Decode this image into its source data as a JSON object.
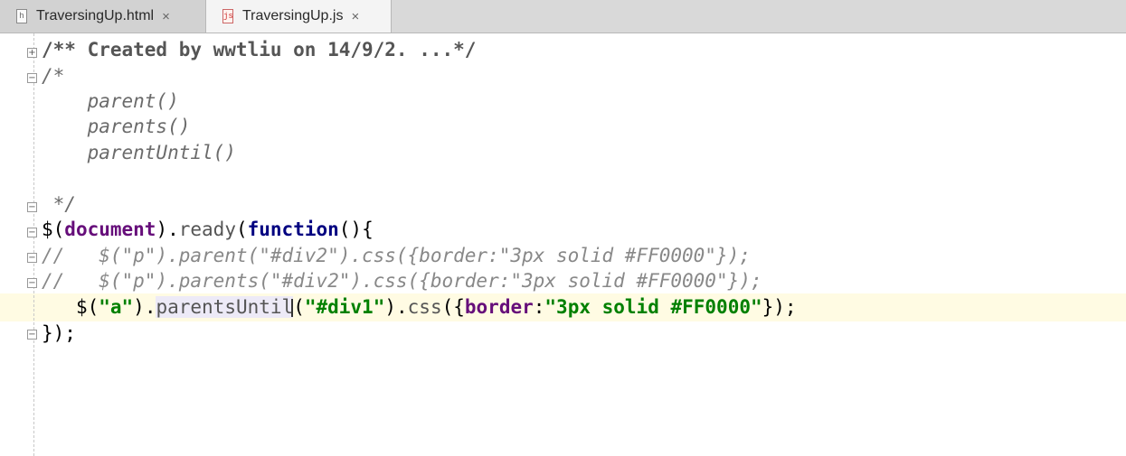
{
  "tabs": [
    {
      "label": "TraversingUp.html",
      "icon": "html-file-icon",
      "active": false
    },
    {
      "label": "TraversingUp.js",
      "icon": "js-file-icon",
      "active": true
    }
  ],
  "tab_close_glyph": "×",
  "fold_glyphs": {
    "expand": "+",
    "collapse": "−"
  },
  "code": {
    "l1": "/** Created by wwtliu on 14/9/2. ...*/",
    "l2": "/*",
    "l3": "    parent()",
    "l4": "    parents()",
    "l5": "    parentUntil()",
    "l7": " */",
    "l8": {
      "a": "$(",
      "b": "document",
      "c": ").",
      "d": "ready",
      "e": "(",
      "f": "function",
      "g": "(){"
    },
    "l9": "//   $(\"p\").parent(\"#div2\").css({border:\"3px solid #FF0000\"});",
    "l10": "//   $(\"p\").parents(\"#div2\").css({border:\"3px solid #FF0000\"});",
    "l11": {
      "indent": "   ",
      "a": "$(",
      "b": "\"a\"",
      "c": ").",
      "d": "parentsUntil",
      "e": "(",
      "f": "\"#div1\"",
      "g": ").",
      "h": "css",
      "i": "({",
      "j": "border",
      "k": ":",
      "l": "\"3px solid #FF0000\"",
      "m": "});"
    },
    "l12": "});"
  }
}
